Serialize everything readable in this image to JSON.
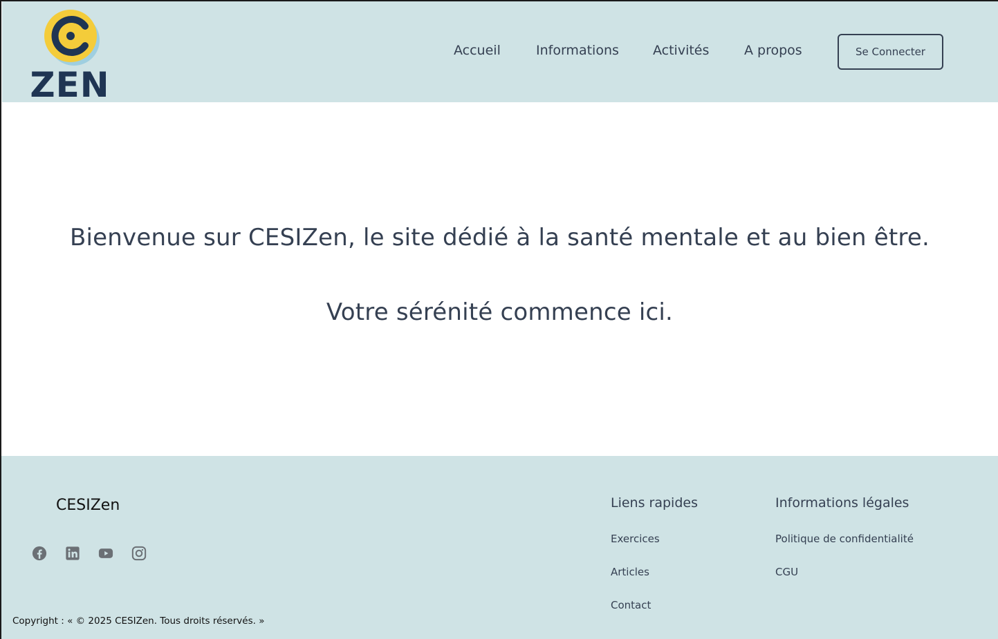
{
  "header": {
    "logo": {
      "text": "ZEN",
      "icon": "c-swirl-logo-icon",
      "colors": {
        "yellow": "#f4cc3a",
        "navy": "#1f3553",
        "light_blue": "#9fcfe0"
      }
    },
    "nav": [
      {
        "label": "Accueil"
      },
      {
        "label": "Informations"
      },
      {
        "label": "Activités"
      },
      {
        "label": "A propos"
      }
    ],
    "login_button": "Se Connecter"
  },
  "main": {
    "welcome_line_1": "Bienvenue sur CESIZen, le site dédié à la santé mentale et au bien être.",
    "welcome_line_2": "Votre sérénité commence ici."
  },
  "footer": {
    "brand": "CESIZen",
    "socials": [
      {
        "icon": "facebook-icon"
      },
      {
        "icon": "linkedin-icon"
      },
      {
        "icon": "youtube-icon"
      },
      {
        "icon": "instagram-icon"
      }
    ],
    "quick_links": {
      "title": "Liens rapides",
      "items": [
        "Exercices",
        "Articles",
        "Contact"
      ]
    },
    "legal": {
      "title": "Informations légales",
      "items": [
        "Politique de confidentialité",
        "CGU"
      ]
    },
    "copyright": "Copyright : « © 2025 CESIZen. Tous droits réservés. »"
  },
  "colors": {
    "header_bg": "#cfe3e5",
    "footer_bg": "#cfe3e5",
    "text": "#354052",
    "page_bg": "#ffffff",
    "social_icon": "#6b7075"
  }
}
